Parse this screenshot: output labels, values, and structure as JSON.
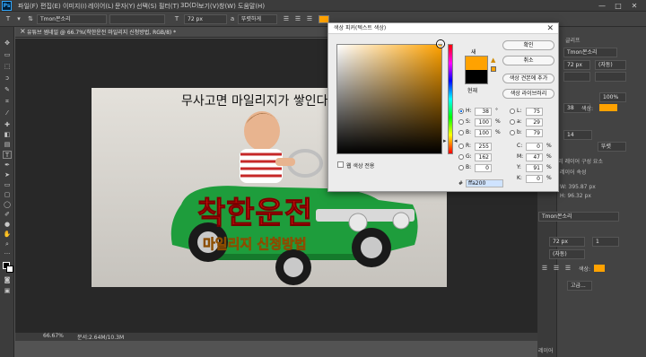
{
  "menubar": {
    "logo": "Ps",
    "items": [
      "파일(F)",
      "편집(E)",
      "이미지(I)",
      "레이어(L)",
      "문자(Y)",
      "선택(S)",
      "필터(T)",
      "3D(D)",
      "보기(V)",
      "창(W)",
      "도움말(H)"
    ],
    "minimize": "—",
    "maximize": "□",
    "close": "✕"
  },
  "options": {
    "font_family": "Tmon몬소리",
    "font_style": "",
    "font_size": "72 px",
    "antialias": "뚜렷하게",
    "text_color": "#ffa200"
  },
  "document": {
    "tab_label": "유튜브 썸네일 @ 66.7%(착한운전 마일리지 신청방법, RGB/8) *",
    "zoom": "66.67%",
    "doc_info": "문서:2.64M/10.3M",
    "headline": "착한운전",
    "subline": "마일리지 신청방법",
    "top_caption": "무사고면 마일리지가 쌓인다"
  },
  "dialog": {
    "title": "색상 피커(텍스트 색상)",
    "close": "✕",
    "ok_label": "확인",
    "cancel_label": "취소",
    "add_swatch_label": "색상 견본에 추가",
    "library_label": "색상 라이브러리",
    "new_label": "새",
    "current_label": "현재",
    "new_color": "#ffa200",
    "current_color": "#000000",
    "web_only_label": "웹 색상 전용",
    "fields": {
      "H": {
        "label": "H:",
        "value": "38",
        "unit": "°"
      },
      "S": {
        "label": "S:",
        "value": "100",
        "unit": "%"
      },
      "B": {
        "label": "B:",
        "value": "100",
        "unit": "%"
      },
      "R": {
        "label": "R:",
        "value": "255",
        "unit": ""
      },
      "G": {
        "label": "G:",
        "value": "162",
        "unit": ""
      },
      "Bl": {
        "label": "B:",
        "value": "0",
        "unit": ""
      },
      "L": {
        "label": "L:",
        "value": "75",
        "unit": ""
      },
      "a": {
        "label": "a:",
        "value": "29",
        "unit": ""
      },
      "b": {
        "label": "b:",
        "value": "79",
        "unit": ""
      },
      "C": {
        "label": "C:",
        "value": "0",
        "unit": "%"
      },
      "M": {
        "label": "M:",
        "value": "47",
        "unit": "%"
      },
      "Y": {
        "label": "Y:",
        "value": "91",
        "unit": "%"
      },
      "K": {
        "label": "K:",
        "value": "0",
        "unit": "%"
      }
    },
    "hex_label": "#",
    "hex_value": "ffa200"
  },
  "panels": {
    "tab_top": "글리프",
    "char_font": "Tmon몬소리",
    "char_size": "72 px",
    "char_leading": "(자동)",
    "char_scale": "100%",
    "char_tracking": "38",
    "color_label": "색상:",
    "color_value": "#ffa200",
    "small_size": "14",
    "small_label": "뚜렷",
    "props_tabs": "라이브러리  레이어 구성 요소",
    "layer_props": "레이어 속성",
    "layer_w": "W: 395.87 px",
    "layer_h": "H: 96.32 px",
    "layer_x": "X:",
    "layer_y": "Y:",
    "lower_font": "Tmon몬소리",
    "lower_size": "72 px",
    "lower_scale": "1",
    "lower_leading": "(자동)",
    "lower_color_label": "색상:",
    "advanced": "고급...",
    "layers_tab": "레이어"
  }
}
